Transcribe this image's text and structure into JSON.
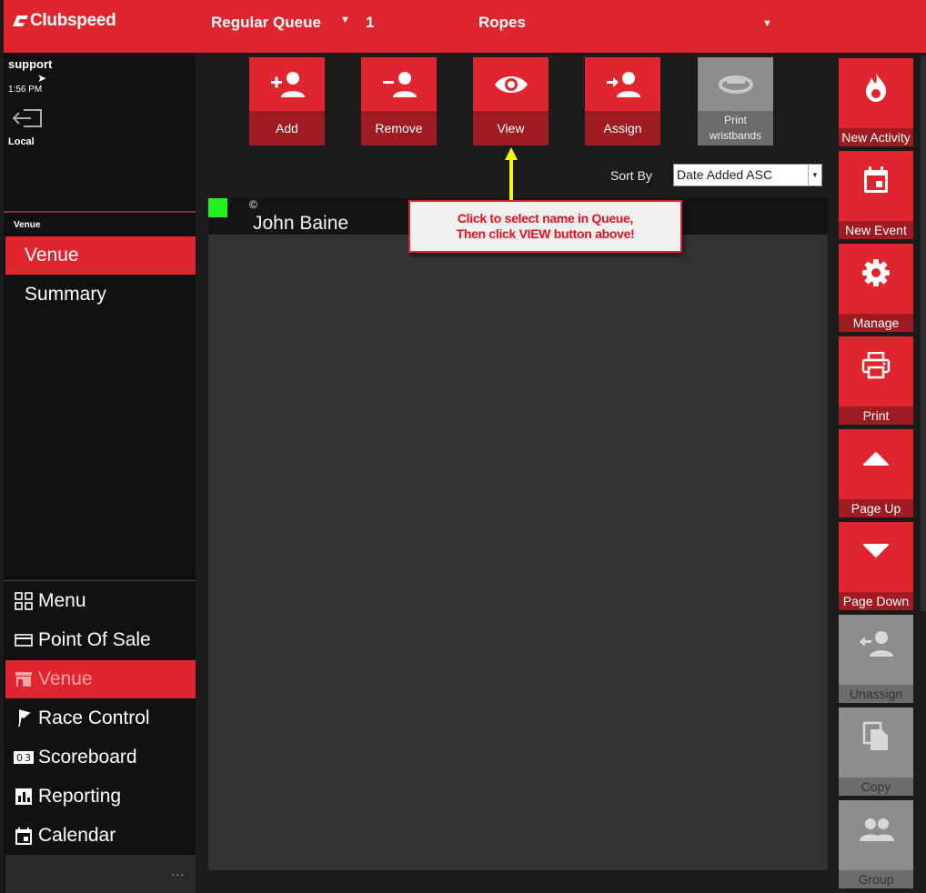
{
  "header": {
    "logo_text": "Clubspeed",
    "queue_name": "Regular Queue",
    "queue_count": "1",
    "track_name": "Ropes"
  },
  "user": {
    "name": "support",
    "time": "1:56 PM",
    "location": "Local"
  },
  "venue_section": {
    "label": "Venue",
    "items": [
      {
        "label": "Venue"
      },
      {
        "label": "Summary"
      }
    ]
  },
  "nav": {
    "items": [
      {
        "label": "Menu"
      },
      {
        "label": "Point Of Sale"
      },
      {
        "label": "Venue"
      },
      {
        "label": "Race Control"
      },
      {
        "label": "Scoreboard"
      },
      {
        "label": "Reporting"
      },
      {
        "label": "Calendar"
      }
    ],
    "more_label": "..."
  },
  "toolbar": {
    "add": "Add",
    "remove": "Remove",
    "view": "View",
    "assign": "Assign",
    "print_wristbands": "Print wristbands"
  },
  "sort": {
    "label": "Sort By",
    "value": "Date Added ASC"
  },
  "queue": {
    "rows": [
      {
        "marker": "©",
        "name": "John Baine"
      }
    ]
  },
  "callout": {
    "line1": "Click to select name in Queue,",
    "line2": "Then click VIEW button above!"
  },
  "right_actions": {
    "new_activity": "New Activity",
    "new_event": "New Event",
    "manage": "Manage",
    "print": "Print",
    "page_up": "Page Up",
    "page_down": "Page Down",
    "unassign": "Unassign",
    "copy": "Copy",
    "group": "Group"
  },
  "colors": {
    "accent": "#e1252f",
    "accent_dark": "#9e1b22",
    "status_green": "#1ff21f",
    "callout_text": "#e8101c",
    "arrow": "#f7f700"
  }
}
